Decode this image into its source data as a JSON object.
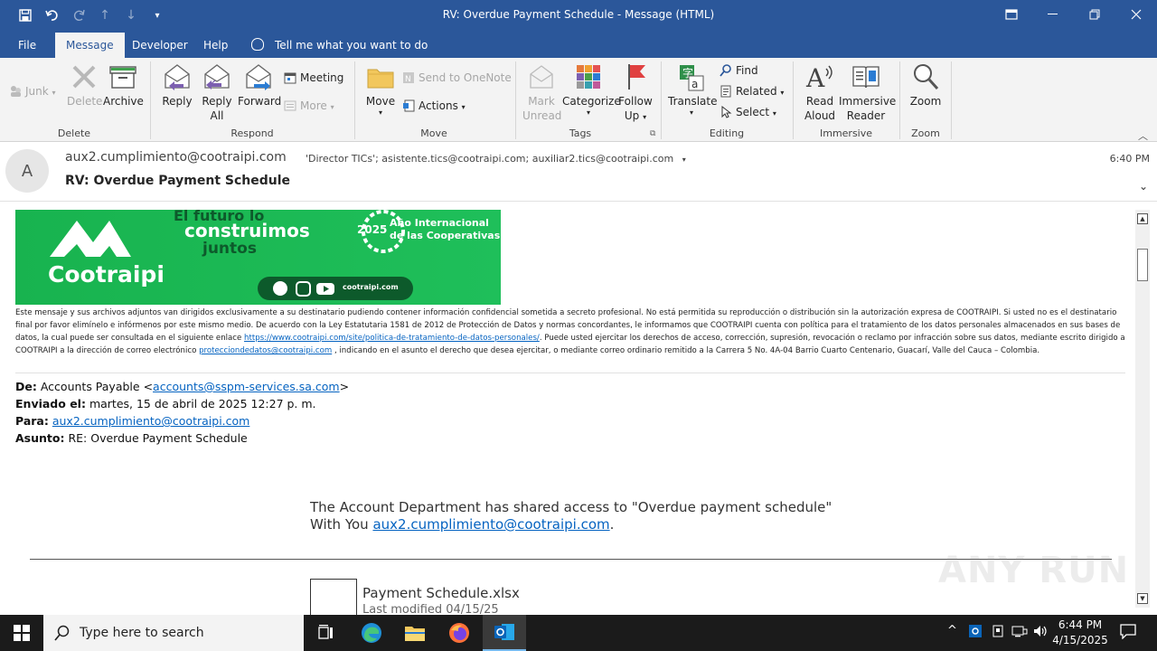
{
  "window": {
    "title": "RV: Overdue Payment Schedule  -  Message (HTML)"
  },
  "menu": {
    "tabs": [
      "File",
      "Message",
      "Developer",
      "Help"
    ],
    "active_tab": "Message",
    "tell_me": "Tell me what you want to do"
  },
  "ribbon": {
    "groups": {
      "delete": "Delete",
      "respond": "Respond",
      "move": "Move",
      "tags": "Tags",
      "editing": "Editing",
      "immersive": "Immersive",
      "zoom": "Zoom"
    },
    "junk": "Junk",
    "delete_btn": "Delete",
    "archive": "Archive",
    "reply": "Reply",
    "reply_all_1": "Reply",
    "reply_all_2": "All",
    "forward": "Forward",
    "meeting": "Meeting",
    "more": "More",
    "move_btn": "Move",
    "send_onenote": "Send to OneNote",
    "actions": "Actions",
    "mark_unread_1": "Mark",
    "mark_unread_2": "Unread",
    "categorize": "Categorize",
    "follow_up_1": "Follow",
    "follow_up_2": "Up",
    "translate": "Translate",
    "find": "Find",
    "related": "Related",
    "select": "Select",
    "read_aloud_1": "Read",
    "read_aloud_2": "Aloud",
    "immersive_1": "Immersive",
    "immersive_2": "Reader",
    "zoom_btn": "Zoom"
  },
  "header": {
    "avatar_letter": "A",
    "from": "aux2.cumplimiento@cootraipi.com",
    "recipients": "'Director TICs'; asistente.tics@cootraipi.com; auxiliar2.tics@cootraipi.com",
    "time": "6:40 PM",
    "subject": "RV: Overdue Payment Schedule"
  },
  "banner": {
    "tagline_1": "El futuro lo",
    "tagline_2": "construimos",
    "tagline_3": "juntos",
    "brand": "Cootraipi",
    "year": "2025",
    "coop_1": "Año Internacional",
    "coop_2": "de las Cooperativas",
    "site": "cootraipi.com"
  },
  "disclaimer": {
    "part1": "Este mensaje y sus archivos adjuntos van dirigidos exclusivamente a su destinatario pudiendo contener información confidencial sometida a secreto profesional. No está permitida su reproducción o distribución sin la autorización expresa de COOTRAIPI. Si usted no es el destinatario final por favor elimínelo e infórmenos por este mismo medio. De acuerdo con la Ley Estatutaria 1581 de 2012 de Protección de Datos y normas concordantes, le informamos que COOTRAIPI cuenta con política para el tratamiento de los datos personales almacenados en sus bases de datos, la cual puede ser consultada en el siguiente enlace ",
    "link1": "https://www.cootraipi.com/site/politica-de-tratamiento-de-datos-personales/",
    "part2": ". Puede usted ejercitar los derechos de acceso, corrección, supresión, revocación o reclamo por infracción sobre sus datos, mediante escrito dirigido a COOTRAIPI a la dirección de correo electrónico ",
    "link2": "protecciondedatos@cootraipi.com",
    "part3": " , indicando en el asunto el derecho que desea ejercitar, o mediante correo ordinario remitido a la Carrera 5 No. 4A-04 Barrio Cuarto Centenario, Guacarí, Valle del Cauca – Colombia."
  },
  "forwarded": {
    "de_label": "De:",
    "de_name": "Accounts Payable <",
    "de_email": "accounts@sspm-services.sa.com",
    "de_close": ">",
    "enviado_label": "Enviado el:",
    "enviado_value": "martes, 15 de abril de 2025 12:27 p. m.",
    "para_label": "Para:",
    "para_value": "aux2.cumplimiento@cootraipi.com",
    "asunto_label": "Asunto:",
    "asunto_value": "RE: Overdue Payment Schedule"
  },
  "content": {
    "shared_line": "The Account Department has shared access to \"Overdue payment schedule\"",
    "with_you": "With You ",
    "with_email": "aux2.cumplimiento@cootraipi.com",
    "period": ".",
    "filename": "Payment Schedule.xlsx",
    "filesub": "Last modified 04/15/25"
  },
  "watermark": "ANY RUN",
  "taskbar": {
    "search_placeholder": "Type here to search",
    "time": "6:44 PM",
    "date": "4/15/2025"
  }
}
